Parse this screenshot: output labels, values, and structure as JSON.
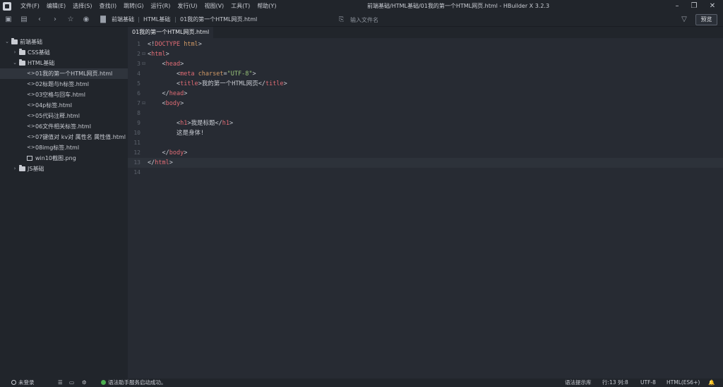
{
  "window": {
    "title": "前端基础/HTML基础/01我的第一个HTML网页.html - HBuilder X 3.2.3",
    "controls": [
      "–",
      "❐",
      "✕"
    ]
  },
  "menu": [
    "文件(F)",
    "编辑(E)",
    "选择(S)",
    "查找(I)",
    "跳转(G)",
    "运行(R)",
    "发行(U)",
    "视图(V)",
    "工具(T)",
    "帮助(Y)"
  ],
  "toolbar": {
    "icons": [
      "new-file-icon",
      "save-icon",
      "back-icon",
      "forward-icon",
      "star-icon",
      "run-icon"
    ],
    "breadcrumb": [
      "前端基础",
      "HTML基础",
      "01我的第一个HTML网页.html"
    ],
    "search_placeholder": "输入文件名",
    "preview_label": "预览"
  },
  "sidebar": {
    "items": [
      {
        "label": "前端基础",
        "type": "folder",
        "level": 0,
        "expanded": true
      },
      {
        "label": "CSS基础",
        "type": "folder",
        "level": 1,
        "expanded": false
      },
      {
        "label": "HTML基础",
        "type": "folder",
        "level": 1,
        "expanded": true
      },
      {
        "label": "01我的第一个HTML网页.html",
        "type": "code",
        "level": 2,
        "active": true
      },
      {
        "label": "02标题与h标签.html",
        "type": "code",
        "level": 2
      },
      {
        "label": "03空格与回车.html",
        "type": "code",
        "level": 2
      },
      {
        "label": "04p标签.html",
        "type": "code",
        "level": 2
      },
      {
        "label": "05代码注释.html",
        "type": "code",
        "level": 2
      },
      {
        "label": "06文件相关标签.html",
        "type": "code",
        "level": 2
      },
      {
        "label": "07键值对 kv对 属性名 属性值.html",
        "type": "code",
        "level": 2
      },
      {
        "label": "08img标签.html",
        "type": "code",
        "level": 2
      },
      {
        "label": "win10截图.png",
        "type": "image",
        "level": 2
      },
      {
        "label": "JS基础",
        "type": "folder",
        "level": 1,
        "expanded": false
      }
    ]
  },
  "editor": {
    "tab": "01我的第一个HTML网页.html",
    "current_line": 13,
    "lines": [
      {
        "n": "1",
        "fold": "",
        "indent": "",
        "parts": [
          [
            "punc",
            "<!"
          ],
          [
            "tag",
            "DOCTYPE"
          ],
          [
            "punc",
            " "
          ],
          [
            "attr",
            "html"
          ],
          [
            "punc",
            ">"
          ]
        ]
      },
      {
        "n": "2",
        "fold": "⊟",
        "indent": "",
        "parts": [
          [
            "punc",
            "<"
          ],
          [
            "tag",
            "html"
          ],
          [
            "punc",
            ">"
          ]
        ]
      },
      {
        "n": "3",
        "fold": "⊟",
        "indent": "    ",
        "parts": [
          [
            "punc",
            "<"
          ],
          [
            "tag",
            "head"
          ],
          [
            "punc",
            ">"
          ]
        ]
      },
      {
        "n": "4",
        "fold": "",
        "indent": "        ",
        "parts": [
          [
            "punc",
            "<"
          ],
          [
            "tag",
            "meta"
          ],
          [
            "punc",
            " "
          ],
          [
            "attr",
            "charset"
          ],
          [
            "punc",
            "="
          ],
          [
            "str",
            "\"UTF-8\""
          ],
          [
            "punc",
            ">"
          ]
        ]
      },
      {
        "n": "5",
        "fold": "",
        "indent": "        ",
        "parts": [
          [
            "punc",
            "<"
          ],
          [
            "tag",
            "title"
          ],
          [
            "punc",
            ">"
          ],
          [
            "txt",
            "我的第一个HTML网页"
          ],
          [
            "punc",
            "</"
          ],
          [
            "tag",
            "title"
          ],
          [
            "punc",
            ">"
          ]
        ]
      },
      {
        "n": "6",
        "fold": "",
        "indent": "    ",
        "parts": [
          [
            "punc",
            "</"
          ],
          [
            "tag",
            "head"
          ],
          [
            "punc",
            ">"
          ]
        ]
      },
      {
        "n": "7",
        "fold": "⊟",
        "indent": "    ",
        "parts": [
          [
            "punc",
            "<"
          ],
          [
            "tag",
            "body"
          ],
          [
            "punc",
            ">"
          ]
        ]
      },
      {
        "n": "8",
        "fold": "",
        "indent": "",
        "parts": []
      },
      {
        "n": "9",
        "fold": "",
        "indent": "        ",
        "parts": [
          [
            "punc",
            "<"
          ],
          [
            "tag",
            "h1"
          ],
          [
            "punc",
            ">"
          ],
          [
            "txt",
            "我是标题"
          ],
          [
            "punc",
            "</"
          ],
          [
            "tag",
            "h1"
          ],
          [
            "punc",
            ">"
          ]
        ]
      },
      {
        "n": "10",
        "fold": "",
        "indent": "        ",
        "parts": [
          [
            "txt",
            "这是身体!"
          ]
        ]
      },
      {
        "n": "11",
        "fold": "",
        "indent": "",
        "parts": []
      },
      {
        "n": "12",
        "fold": "",
        "indent": "    ",
        "parts": [
          [
            "punc",
            "</"
          ],
          [
            "tag",
            "body"
          ],
          [
            "punc",
            ">"
          ]
        ]
      },
      {
        "n": "13",
        "fold": "",
        "indent": "",
        "parts": [
          [
            "punc",
            "</"
          ],
          [
            "tag",
            "html"
          ],
          [
            "punc",
            ">"
          ]
        ]
      },
      {
        "n": "14",
        "fold": "",
        "indent": "",
        "parts": []
      }
    ]
  },
  "status": {
    "user": "未登录",
    "message": "语法助手服务启动成功。",
    "syntax_tip": "语法提示库",
    "position": "行:13  列:8",
    "encoding": "UTF-8",
    "language": "HTML(ES6+)"
  },
  "colors": {
    "tag": "#e06c75",
    "attr": "#d19a66",
    "string": "#98c379",
    "ok": "#4caf50"
  }
}
